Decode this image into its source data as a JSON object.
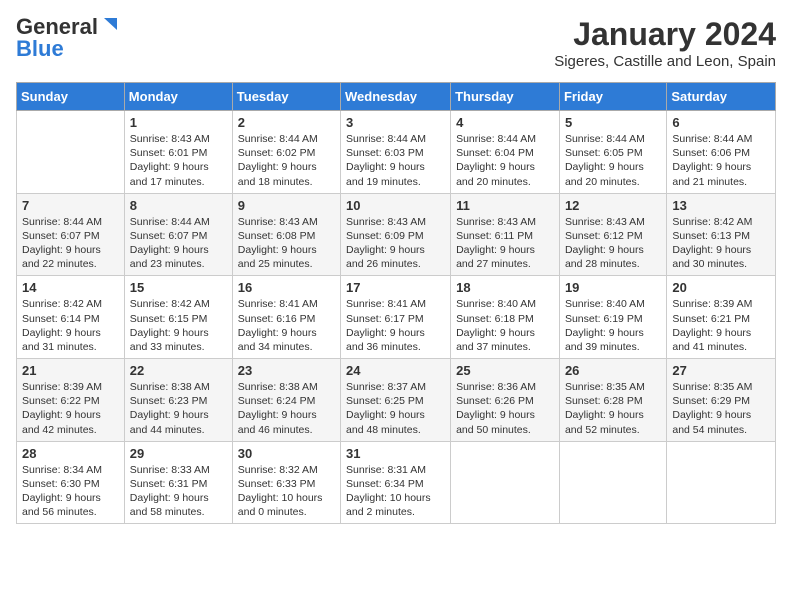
{
  "header": {
    "logo_general": "General",
    "logo_blue": "Blue",
    "title": "January 2024",
    "subtitle": "Sigeres, Castille and Leon, Spain"
  },
  "weekdays": [
    "Sunday",
    "Monday",
    "Tuesday",
    "Wednesday",
    "Thursday",
    "Friday",
    "Saturday"
  ],
  "weeks": [
    [
      {
        "day": "",
        "info": ""
      },
      {
        "day": "1",
        "info": "Sunrise: 8:43 AM\nSunset: 6:01 PM\nDaylight: 9 hours\nand 17 minutes."
      },
      {
        "day": "2",
        "info": "Sunrise: 8:44 AM\nSunset: 6:02 PM\nDaylight: 9 hours\nand 18 minutes."
      },
      {
        "day": "3",
        "info": "Sunrise: 8:44 AM\nSunset: 6:03 PM\nDaylight: 9 hours\nand 19 minutes."
      },
      {
        "day": "4",
        "info": "Sunrise: 8:44 AM\nSunset: 6:04 PM\nDaylight: 9 hours\nand 20 minutes."
      },
      {
        "day": "5",
        "info": "Sunrise: 8:44 AM\nSunset: 6:05 PM\nDaylight: 9 hours\nand 20 minutes."
      },
      {
        "day": "6",
        "info": "Sunrise: 8:44 AM\nSunset: 6:06 PM\nDaylight: 9 hours\nand 21 minutes."
      }
    ],
    [
      {
        "day": "7",
        "info": "Sunrise: 8:44 AM\nSunset: 6:07 PM\nDaylight: 9 hours\nand 22 minutes."
      },
      {
        "day": "8",
        "info": "Sunrise: 8:44 AM\nSunset: 6:07 PM\nDaylight: 9 hours\nand 23 minutes."
      },
      {
        "day": "9",
        "info": "Sunrise: 8:43 AM\nSunset: 6:08 PM\nDaylight: 9 hours\nand 25 minutes."
      },
      {
        "day": "10",
        "info": "Sunrise: 8:43 AM\nSunset: 6:09 PM\nDaylight: 9 hours\nand 26 minutes."
      },
      {
        "day": "11",
        "info": "Sunrise: 8:43 AM\nSunset: 6:11 PM\nDaylight: 9 hours\nand 27 minutes."
      },
      {
        "day": "12",
        "info": "Sunrise: 8:43 AM\nSunset: 6:12 PM\nDaylight: 9 hours\nand 28 minutes."
      },
      {
        "day": "13",
        "info": "Sunrise: 8:42 AM\nSunset: 6:13 PM\nDaylight: 9 hours\nand 30 minutes."
      }
    ],
    [
      {
        "day": "14",
        "info": "Sunrise: 8:42 AM\nSunset: 6:14 PM\nDaylight: 9 hours\nand 31 minutes."
      },
      {
        "day": "15",
        "info": "Sunrise: 8:42 AM\nSunset: 6:15 PM\nDaylight: 9 hours\nand 33 minutes."
      },
      {
        "day": "16",
        "info": "Sunrise: 8:41 AM\nSunset: 6:16 PM\nDaylight: 9 hours\nand 34 minutes."
      },
      {
        "day": "17",
        "info": "Sunrise: 8:41 AM\nSunset: 6:17 PM\nDaylight: 9 hours\nand 36 minutes."
      },
      {
        "day": "18",
        "info": "Sunrise: 8:40 AM\nSunset: 6:18 PM\nDaylight: 9 hours\nand 37 minutes."
      },
      {
        "day": "19",
        "info": "Sunrise: 8:40 AM\nSunset: 6:19 PM\nDaylight: 9 hours\nand 39 minutes."
      },
      {
        "day": "20",
        "info": "Sunrise: 8:39 AM\nSunset: 6:21 PM\nDaylight: 9 hours\nand 41 minutes."
      }
    ],
    [
      {
        "day": "21",
        "info": "Sunrise: 8:39 AM\nSunset: 6:22 PM\nDaylight: 9 hours\nand 42 minutes."
      },
      {
        "day": "22",
        "info": "Sunrise: 8:38 AM\nSunset: 6:23 PM\nDaylight: 9 hours\nand 44 minutes."
      },
      {
        "day": "23",
        "info": "Sunrise: 8:38 AM\nSunset: 6:24 PM\nDaylight: 9 hours\nand 46 minutes."
      },
      {
        "day": "24",
        "info": "Sunrise: 8:37 AM\nSunset: 6:25 PM\nDaylight: 9 hours\nand 48 minutes."
      },
      {
        "day": "25",
        "info": "Sunrise: 8:36 AM\nSunset: 6:26 PM\nDaylight: 9 hours\nand 50 minutes."
      },
      {
        "day": "26",
        "info": "Sunrise: 8:35 AM\nSunset: 6:28 PM\nDaylight: 9 hours\nand 52 minutes."
      },
      {
        "day": "27",
        "info": "Sunrise: 8:35 AM\nSunset: 6:29 PM\nDaylight: 9 hours\nand 54 minutes."
      }
    ],
    [
      {
        "day": "28",
        "info": "Sunrise: 8:34 AM\nSunset: 6:30 PM\nDaylight: 9 hours\nand 56 minutes."
      },
      {
        "day": "29",
        "info": "Sunrise: 8:33 AM\nSunset: 6:31 PM\nDaylight: 9 hours\nand 58 minutes."
      },
      {
        "day": "30",
        "info": "Sunrise: 8:32 AM\nSunset: 6:33 PM\nDaylight: 10 hours\nand 0 minutes."
      },
      {
        "day": "31",
        "info": "Sunrise: 8:31 AM\nSunset: 6:34 PM\nDaylight: 10 hours\nand 2 minutes."
      },
      {
        "day": "",
        "info": ""
      },
      {
        "day": "",
        "info": ""
      },
      {
        "day": "",
        "info": ""
      }
    ]
  ]
}
